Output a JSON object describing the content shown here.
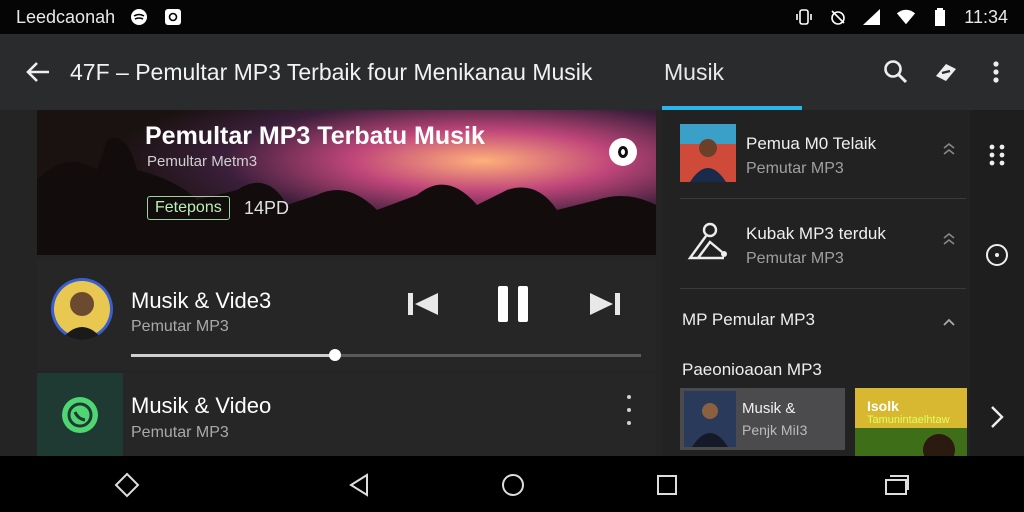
{
  "status_bar": {
    "carrier": "Leedcaonah",
    "time": "11:34"
  },
  "app_bar": {
    "title": "47F – Pemultar MP3 Terbaik four Menikanau Musik",
    "tab": "Musik"
  },
  "hero": {
    "title": "Pemultar MP3 Terbatu Musik",
    "subtitle": "Pemultar Metm3",
    "badge": "Fetepons",
    "badge2": "14PD"
  },
  "player": {
    "title": "Musik & Vide3",
    "subtitle": "Pemutar MP3",
    "progress": 0.4
  },
  "list_item": {
    "title": "Musik & Video",
    "subtitle": "Pemutar MP3"
  },
  "side_list": [
    {
      "title": "Pemua M0 Telaik",
      "subtitle": "Pemutar MP3"
    },
    {
      "title": "Kubak MP3 terduk",
      "subtitle": "Pemutar MP3"
    }
  ],
  "section": {
    "title": "MP Pemular MP3",
    "subtitle": "Paeonioaoan MP3"
  },
  "cards": [
    {
      "title": "Musik &",
      "subtitle": "Penjk MiI3"
    },
    {
      "title": "Isolk",
      "subtitle": "Tamunintaelhtaw"
    }
  ],
  "colors": {
    "accent": "#29b6e8",
    "appbar": "#2a2b2d",
    "background": "#242424"
  }
}
